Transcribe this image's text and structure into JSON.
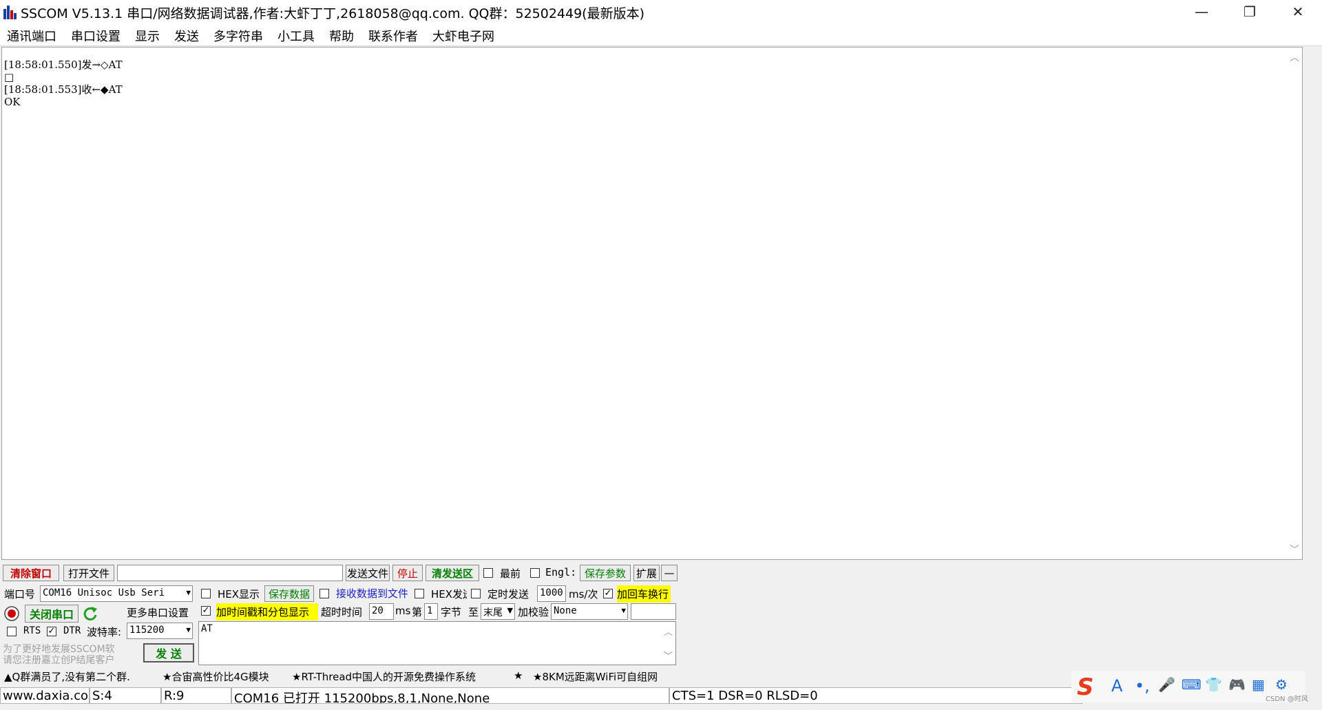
{
  "window": {
    "title": "SSCOM V5.13.1 串口/网络数据调试器,作者:大虾丁丁,2618058@qq.com. QQ群：52502449(最新版本)",
    "minimize_glyph": "—",
    "restore_glyph": "❐",
    "close_glyph": "✕"
  },
  "menu": [
    "通讯端口",
    "串口设置",
    "显示",
    "发送",
    "多字符串",
    "小工具",
    "帮助",
    "联系作者",
    "大虾电子网"
  ],
  "receive": {
    "lines": [
      "[18:58:01.550]发→◇AT",
      "□",
      "[18:58:01.553]收←◆AT",
      "OK"
    ],
    "scroll_up": "︿",
    "scroll_down": "﹀"
  },
  "toolbar1": {
    "clear_window": "清除窗口",
    "open_file": "打开文件",
    "file_path": "",
    "send_file": "发送文件",
    "stop": "停止",
    "clear_send": "清发送区",
    "topmost": "最前",
    "english": "Engl:",
    "save_params": "保存参数",
    "expand": "扩展",
    "collapse": "—"
  },
  "port": {
    "port_label": "端口号",
    "port_value": "COM16 Unisoc Usb Seri",
    "close_port": "关闭串口",
    "more_settings": "更多串口设置",
    "rts": "RTS",
    "dtr": "DTR",
    "baud_label": "波特率:",
    "baud_value": "115200",
    "promo": [
      "为了更好地发展SSCOM软",
      "请您注册嘉立创P结尾客户"
    ],
    "send_button": "发  送"
  },
  "options": {
    "hex_display": "HEX显示",
    "save_data": "保存数据",
    "recv_to_file": "接收数据到文件",
    "hex_send": "HEX发送",
    "timed_send": "定时发送",
    "interval": "1000",
    "interval_unit": "ms/次",
    "add_crlf": "加回车换行",
    "timestamp": "加时间戳和分包显示",
    "timeout_label": "超时时间",
    "timeout_value": "20",
    "timeout_unit": "ms",
    "nth_label": "第",
    "nth_value": "1",
    "byte_label": "字节",
    "to_label": "至",
    "end_value": "末尾",
    "checksum_label": "加校验",
    "checksum_value": "None"
  },
  "send_text": "AT",
  "ticker": [
    "▲Q群满员了,没有第二个群.",
    "★合宙高性价比4G模块",
    "★RT-Thread中国人的开源免费操作系统",
    "★",
    "★8KM远距离WiFi可自组网"
  ],
  "status": {
    "website": "www.daxia.com",
    "sent": "S:4",
    "received": "R:9",
    "port_state": "COM16 已打开  115200bps,8,1,None,None",
    "lines": "CTS=1 DSR=0 RLSD=0"
  },
  "ime": {
    "logo": "S",
    "icons": [
      "A",
      "•,",
      "🎤",
      "⌨",
      "👕",
      "🎮",
      "▦",
      "⚙"
    ],
    "watermark": "CSDN @时风"
  },
  "colors": {
    "ime_logo": "#e83d1a",
    "accent_blue": "#1a6bd6"
  }
}
